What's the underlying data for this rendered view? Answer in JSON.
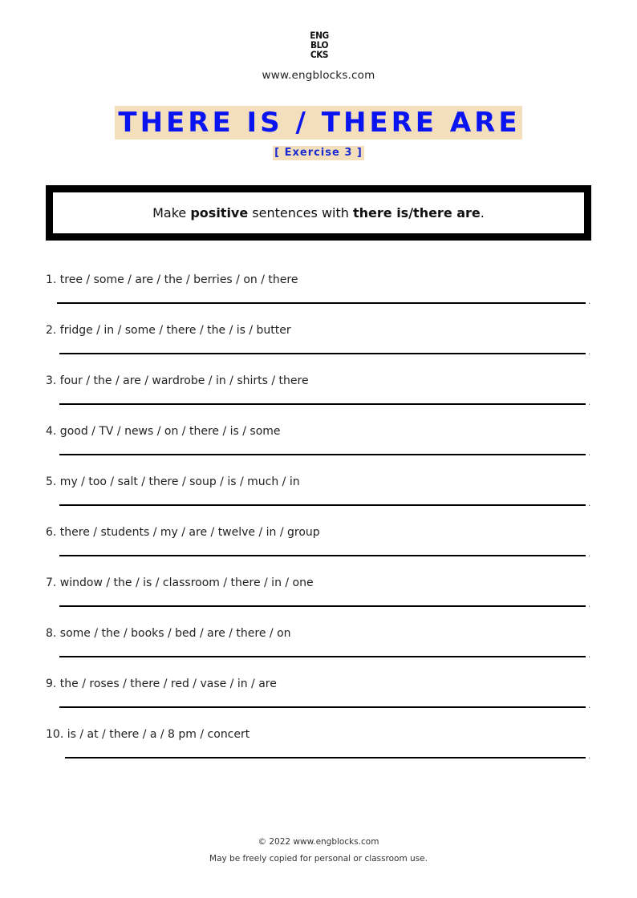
{
  "header": {
    "logo_lines": [
      "ENG",
      "BLO",
      "CKS"
    ],
    "site_url": "www.engblocks.com"
  },
  "title": {
    "main": "THERE IS / THERE ARE",
    "subtitle": "[ Exercise 3 ]",
    "highlight_color": "#f3dfbc",
    "text_color": "#0a14f0"
  },
  "instructions": {
    "part1": "Make ",
    "bold1": "positive",
    "part2": " sentences with ",
    "bold2": "there is/there are",
    "part3": "."
  },
  "exercises": [
    {
      "prompt": "1. tree / some / are / the / berries / on / there",
      "answer": ""
    },
    {
      "prompt": "2. fridge / in / some / there / the / is / butter",
      "answer": ""
    },
    {
      "prompt": "3. four / the / are / wardrobe / in / shirts / there",
      "answer": ""
    },
    {
      "prompt": "4. good / TV / news / on / there / is / some",
      "answer": ""
    },
    {
      "prompt": "5. my / too / salt / there / soup / is / much / in",
      "answer": ""
    },
    {
      "prompt": "6. there / students / my / are / twelve / in / group",
      "answer": ""
    },
    {
      "prompt": "7. window / the / is / classroom / there / in / one",
      "answer": ""
    },
    {
      "prompt": "8. some / the / books / bed / are / there / on",
      "answer": ""
    },
    {
      "prompt": "9. the / roses / there / red / vase / in / are",
      "answer": ""
    },
    {
      "prompt": "10. is / at / there / a / 8 pm / concert",
      "answer": ""
    }
  ],
  "line_end_mark": ".",
  "footer": {
    "copyright": "© 2022 www.engblocks.com",
    "license": "May be freely copied for personal or classroom use."
  }
}
